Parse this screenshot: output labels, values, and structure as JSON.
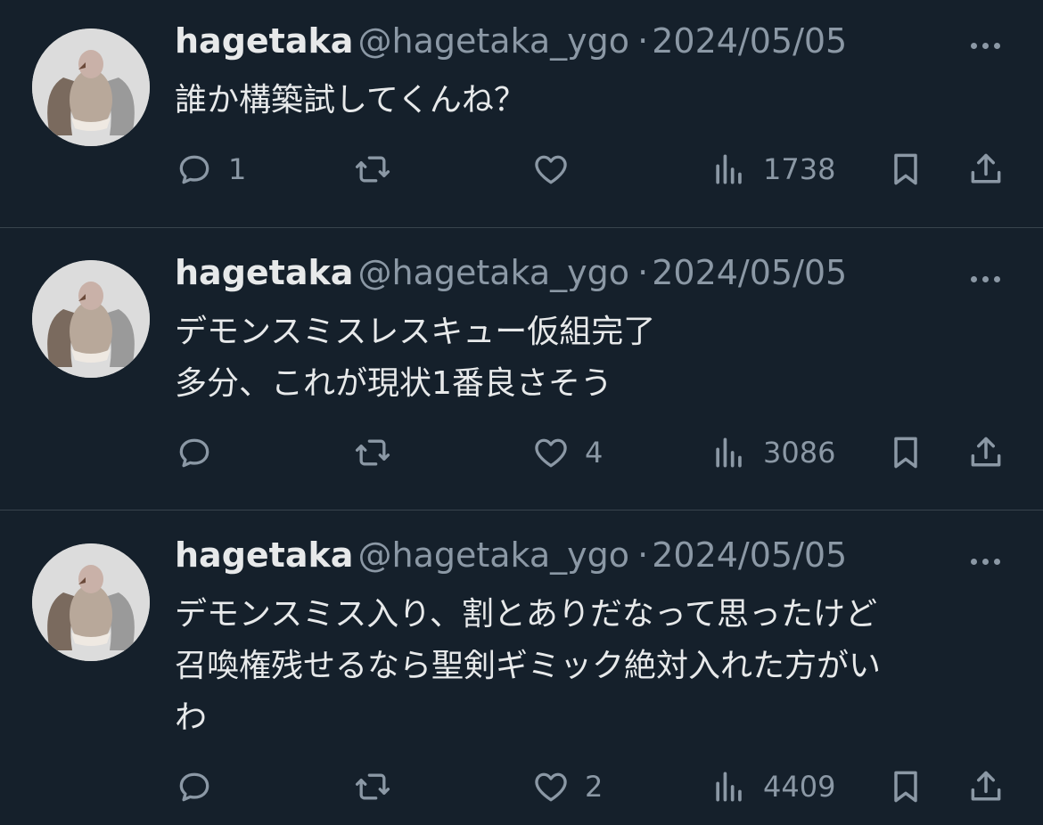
{
  "tweets": [
    {
      "name": "hagetaka",
      "handle": "@hagetaka_ygo",
      "sep": "·",
      "date": "2024/05/05",
      "lines": [
        "誰か構築試してくんね？"
      ],
      "replies": "1",
      "retweets": "",
      "likes": "",
      "views": "1738"
    },
    {
      "name": "hagetaka",
      "handle": "@hagetaka_ygo",
      "sep": "·",
      "date": "2024/05/05",
      "lines": [
        "デモンスミスレスキュー仮組完了",
        "多分、これが現状1番良さそう"
      ],
      "replies": "",
      "retweets": "",
      "likes": "4",
      "views": "3086"
    },
    {
      "name": "hagetaka",
      "handle": "@hagetaka_ygo",
      "sep": "·",
      "date": "2024/05/05",
      "lines": [
        "デモンスミス入り、割とありだなって思ったけど",
        "召喚権残せるなら聖剣ギミック絶対入れた方がい",
        "わ"
      ],
      "replies": "",
      "retweets": "",
      "likes": "2",
      "views": "4409"
    }
  ],
  "icons": {
    "avatar": "vulture-avatar",
    "more": "more-icon",
    "reply": "reply-icon",
    "retweet": "retweet-icon",
    "like": "like-icon",
    "views": "views-icon",
    "bookmark": "bookmark-icon",
    "share": "share-icon"
  },
  "colors": {
    "background": "#15202b",
    "text": "#e7e9ea",
    "secondary": "#8b98a5",
    "divider": "#38444d"
  }
}
